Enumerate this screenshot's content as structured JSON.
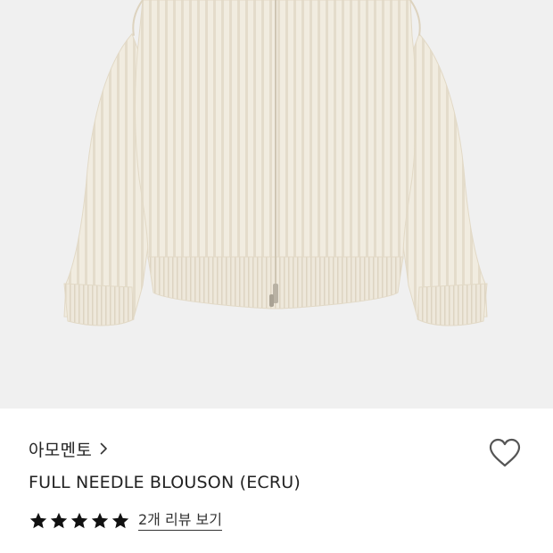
{
  "product": {
    "image_alt": "Ivory ribbed knit zip-up cardigan",
    "brand": "아모멘토",
    "title": "FULL NEEDLE BLOUSON (ECRU)",
    "rating": 5,
    "rating_max": 5,
    "review_link": "2개 리뷰 보기"
  },
  "icons": {
    "brand_chevron": "chevron-right-icon",
    "like": "heart-outline-icon",
    "star": "star-filled-icon"
  },
  "colors": {
    "image_background": "#f0f0f0",
    "garment": "#f1ece0",
    "text": "#222222",
    "heart_stroke": "#555555"
  }
}
